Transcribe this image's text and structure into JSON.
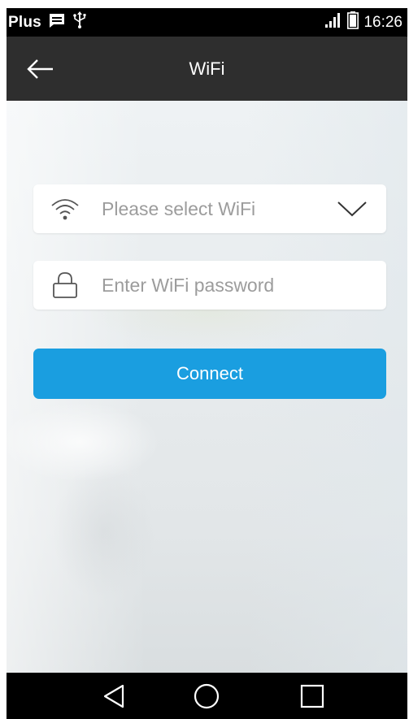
{
  "status_bar": {
    "carrier": "Plus",
    "time": "16:26",
    "icons": [
      "message-icon",
      "usb-icon",
      "signal-icon",
      "battery-icon"
    ]
  },
  "app_bar": {
    "title": "WiFi",
    "back_icon": "arrow-left-icon"
  },
  "form": {
    "wifi_select": {
      "placeholder": "Please select WiFi",
      "icon": "wifi-icon",
      "dropdown_icon": "chevron-down-icon"
    },
    "password": {
      "placeholder": "Enter WiFi password",
      "value": "",
      "icon": "lock-icon"
    },
    "connect_label": "Connect"
  },
  "nav_bar": {
    "items": [
      "back-triangle-icon",
      "home-circle-icon",
      "recents-square-icon"
    ]
  },
  "colors": {
    "accent": "#1a9ee0",
    "app_bar": "#2e2e2e",
    "status_bar": "#000000",
    "placeholder": "#9c9c9c"
  }
}
